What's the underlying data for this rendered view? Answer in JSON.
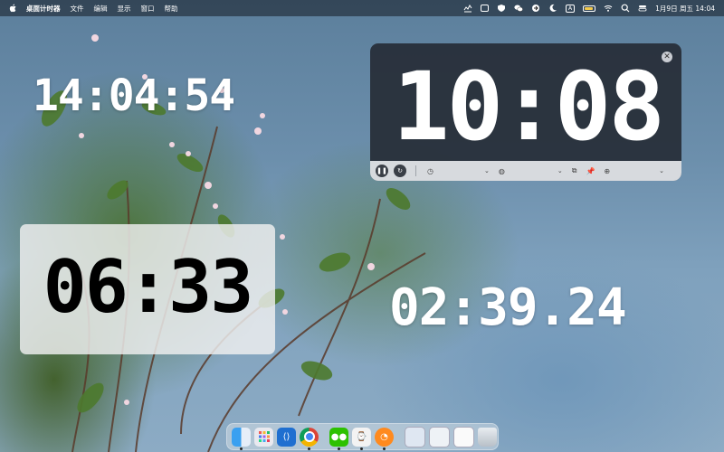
{
  "menubar": {
    "app_name": "桌面计时器",
    "menus": [
      "文件",
      "编辑",
      "显示",
      "窗口",
      "帮助"
    ],
    "date_time": "1月9日 周五  14:04",
    "input_indicator": "A",
    "battery_level": 0.85
  },
  "clocks": {
    "clock_1": "14:04:54",
    "clock_2": "10:08",
    "clock_3": "06:33",
    "clock_4": "02:39.24"
  },
  "colors": {
    "dark_panel": "#262c36",
    "toolbar": "#d7dade",
    "pin_accent": "#2f6fdc",
    "battery": "#f2c94c"
  },
  "toolbar_icons": [
    "pause-icon",
    "reset-icon",
    "timer-icon",
    "palette-icon",
    "copy-icon",
    "pin-icon",
    "globe-icon"
  ],
  "dock": {
    "apps": [
      "finder",
      "launchpad",
      "vscode",
      "chrome",
      "wechat",
      "desktop-timer-app",
      "clock-app",
      "preview",
      "preview",
      "screenshot",
      "trash"
    ]
  }
}
